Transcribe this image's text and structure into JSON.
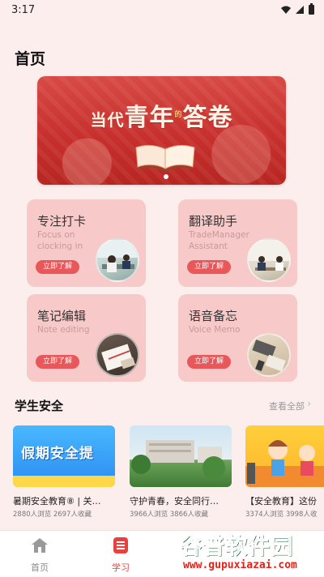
{
  "status_bar": {
    "time": "3:17"
  },
  "page_title": "首页",
  "banner": {
    "title_part1": "当代",
    "title_part2": "青年",
    "title_part3": "的",
    "title_part4": "答卷"
  },
  "cards": [
    {
      "title": "专注打卡",
      "subtitle": "Focus on clocking in",
      "button": "立即了解"
    },
    {
      "title": "翻译助手",
      "subtitle": "TradeManager Assistant",
      "button": "立即了解"
    },
    {
      "title": "笔记编辑",
      "subtitle": "Note editing",
      "button": "立即了解"
    },
    {
      "title": "语音备忘",
      "subtitle": "Voice Memo",
      "button": "立即了解"
    }
  ],
  "section": {
    "title": "学生安全",
    "view_all": "查看全部"
  },
  "articles": [
    {
      "thumb_text": "假期安全提",
      "title": "暑期安全教育⑧ | 关…",
      "stats": "2880人浏览   2697人收藏"
    },
    {
      "title": "守护青春，安全同行…",
      "stats": "3966人浏览   3866人收藏"
    },
    {
      "title": "【安全教育】这份",
      "stats": "3374人浏览   3998人收"
    }
  ],
  "bottom_nav": [
    {
      "label": "首页",
      "active": false
    },
    {
      "label": "学习",
      "active": true
    }
  ],
  "watermark": {
    "big": "谷普软件园",
    "small": "www.gupuxiazai.com"
  },
  "colors": {
    "accent": "#e8403f",
    "card_bg": "#f8c9c9",
    "page_bg": "#fdeeee"
  }
}
